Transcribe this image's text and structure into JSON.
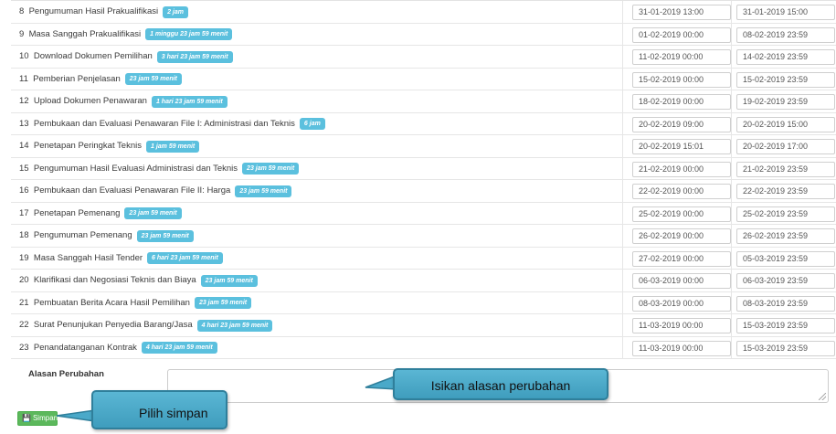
{
  "schedule": [
    {
      "no": "8",
      "label": "Pengumuman Hasil Prakualifikasi",
      "duration": "2 jam",
      "start": "31-01-2019 13:00",
      "end": "31-01-2019 15:00"
    },
    {
      "no": "9",
      "label": "Masa Sanggah Prakualifikasi",
      "duration": "1 minggu 23 jam 59 menit",
      "start": "01-02-2019 00:00",
      "end": "08-02-2019 23:59"
    },
    {
      "no": "10",
      "label": "Download Dokumen Pemilihan",
      "duration": "3 hari 23 jam 59 menit",
      "start": "11-02-2019 00:00",
      "end": "14-02-2019 23:59"
    },
    {
      "no": "11",
      "label": "Pemberian Penjelasan",
      "duration": "23 jam 59 menit",
      "start": "15-02-2019 00:00",
      "end": "15-02-2019 23:59"
    },
    {
      "no": "12",
      "label": "Upload Dokumen Penawaran",
      "duration": "1 hari 23 jam 59 menit",
      "start": "18-02-2019 00:00",
      "end": "19-02-2019 23:59"
    },
    {
      "no": "13",
      "label": "Pembukaan dan Evaluasi Penawaran File I: Administrasi dan Teknis",
      "duration": "6 jam",
      "start": "20-02-2019 09:00",
      "end": "20-02-2019 15:00"
    },
    {
      "no": "14",
      "label": "Penetapan Peringkat Teknis",
      "duration": "1 jam 59 menit",
      "start": "20-02-2019 15:01",
      "end": "20-02-2019 17:00"
    },
    {
      "no": "15",
      "label": "Pengumuman Hasil Evaluasi Administrasi dan Teknis",
      "duration": "23 jam 59 menit",
      "start": "21-02-2019 00:00",
      "end": "21-02-2019 23:59"
    },
    {
      "no": "16",
      "label": "Pembukaan dan Evaluasi Penawaran File II: Harga",
      "duration": "23 jam 59 menit",
      "start": "22-02-2019 00:00",
      "end": "22-02-2019 23:59"
    },
    {
      "no": "17",
      "label": "Penetapan Pemenang",
      "duration": "23 jam 59 menit",
      "start": "25-02-2019 00:00",
      "end": "25-02-2019 23:59"
    },
    {
      "no": "18",
      "label": "Pengumuman Pemenang",
      "duration": "23 jam 59 menit",
      "start": "26-02-2019 00:00",
      "end": "26-02-2019 23:59"
    },
    {
      "no": "19",
      "label": "Masa Sanggah Hasil Tender",
      "duration": "6 hari 23 jam 59 menit",
      "start": "27-02-2019 00:00",
      "end": "05-03-2019 23:59"
    },
    {
      "no": "20",
      "label": "Klarifikasi dan Negosiasi Teknis dan Biaya",
      "duration": "23 jam 59 menit",
      "start": "06-03-2019 00:00",
      "end": "06-03-2019 23:59"
    },
    {
      "no": "21",
      "label": "Pembuatan Berita Acara Hasil Pemilihan",
      "duration": "23 jam 59 menit",
      "start": "08-03-2019 00:00",
      "end": "08-03-2019 23:59"
    },
    {
      "no": "22",
      "label": "Surat Penunjukan Penyedia Barang/Jasa",
      "duration": "4 hari 23 jam 59 menit",
      "start": "11-03-2019 00:00",
      "end": "15-03-2019 23:59"
    },
    {
      "no": "23",
      "label": "Penandatanganan Kontrak",
      "duration": "4 hari 23 jam 59 menit",
      "start": "11-03-2019 00:00",
      "end": "15-03-2019 23:59"
    }
  ],
  "reason": {
    "label": "Alasan Perubahan",
    "value": ""
  },
  "save_button": {
    "icon": "save-icon",
    "label": "Simpan"
  },
  "callouts": {
    "reason": "Isikan alasan perubahan",
    "save": "Pilih simpan"
  },
  "colors": {
    "badge": "#5bc0de",
    "save_button": "#5cb85c",
    "callout": "#4aa9c9"
  }
}
